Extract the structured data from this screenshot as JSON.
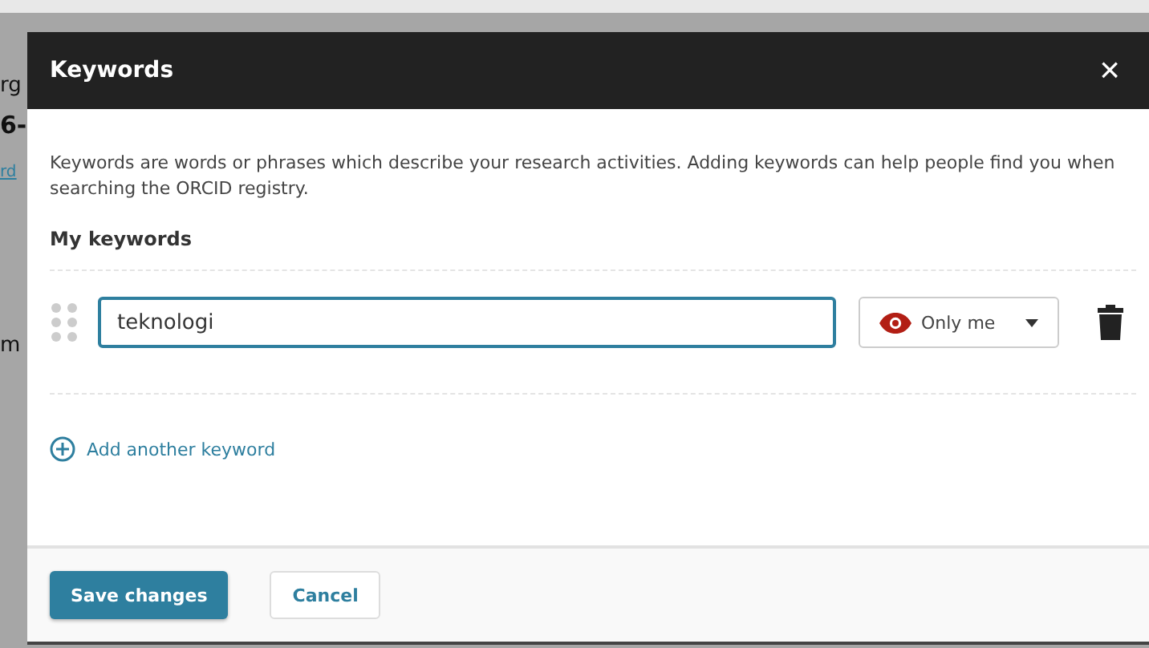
{
  "background": {
    "texts": [
      {
        "text": "rg",
        "kind": "plain"
      },
      {
        "text": "6-",
        "kind": "heading"
      },
      {
        "text": "rd",
        "kind": "link"
      },
      {
        "text": "m",
        "kind": "plain"
      }
    ]
  },
  "modal": {
    "title": "Keywords",
    "close": "×",
    "description": "Keywords are words or phrases which describe your research activities. Adding keywords can help people find you when searching the ORCID registry.",
    "section_title": "My keywords",
    "keywords": [
      {
        "value": "teknologi",
        "focused": true,
        "visibility": "Only me"
      }
    ],
    "add_link": "Add another keyword",
    "buttons": [
      {
        "label": "Save changes",
        "kind": "primary"
      },
      {
        "label": "Cancel",
        "kind": "secondary"
      }
    ]
  }
}
